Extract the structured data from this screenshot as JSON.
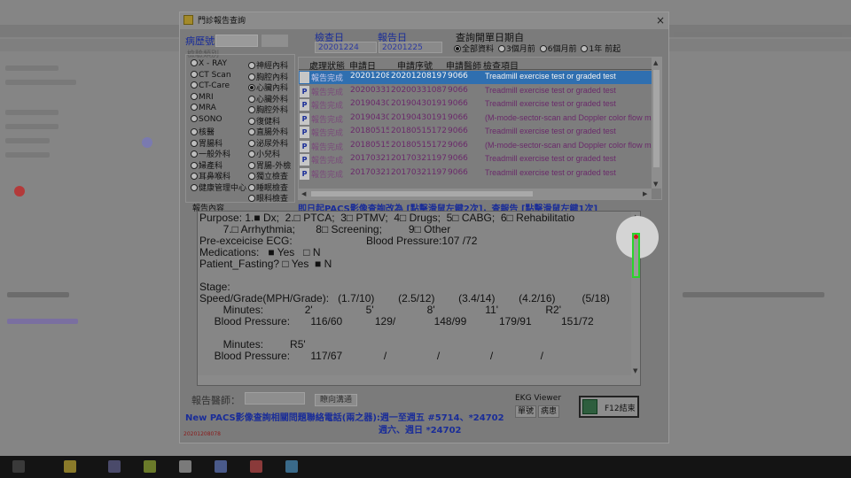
{
  "window": {
    "title": "門診報告查詢",
    "close": "×"
  },
  "top": {
    "chart_no_label": "病歷號",
    "exam_date_label": "檢查日",
    "exam_date": "20201224",
    "report_date_label": "報告日",
    "report_date": "20201225",
    "query_label": "查詢開單日期自",
    "ranges": [
      {
        "label": "全部資料",
        "selected": true
      },
      {
        "label": "3個月前",
        "selected": false
      },
      {
        "label": "6個月前",
        "selected": false
      },
      {
        "label": "1年 前起",
        "selected": false
      }
    ]
  },
  "category": {
    "legend": "檢驗類別",
    "left": [
      {
        "label": "X - RAY",
        "selected": false
      },
      {
        "label": "CT Scan",
        "selected": false
      },
      {
        "label": "CT-Care",
        "selected": false
      },
      {
        "label": "MRI",
        "selected": false
      },
      {
        "label": "MRA",
        "selected": false
      },
      {
        "label": "SONO",
        "selected": false
      },
      {
        "label": "核醫",
        "selected": false
      },
      {
        "label": "胃腸科",
        "selected": false
      },
      {
        "label": "一般外科",
        "selected": false
      },
      {
        "label": "婦產科",
        "selected": false
      },
      {
        "label": "耳鼻喉科",
        "selected": false
      },
      {
        "label": "健康管理中心",
        "selected": false
      }
    ],
    "right": [
      {
        "label": "神經內科",
        "selected": false
      },
      {
        "label": "胸腔內科",
        "selected": false
      },
      {
        "label": "心臟內科",
        "selected": true
      },
      {
        "label": "心臟外科",
        "selected": false
      },
      {
        "label": "胸腔外科",
        "selected": false
      },
      {
        "label": "復健科",
        "selected": false
      },
      {
        "label": "直腸外科",
        "selected": false
      },
      {
        "label": "泌尿外科",
        "selected": false
      },
      {
        "label": "小兒科",
        "selected": false
      },
      {
        "label": "胃腸-外檢",
        "selected": false
      },
      {
        "label": "獨立檢查",
        "selected": false
      },
      {
        "label": "睡眠檢查",
        "selected": false
      },
      {
        "label": "眼科檢查",
        "selected": false
      }
    ]
  },
  "table": {
    "headers": [
      "處理狀態",
      "申請日",
      "申請序號",
      "申請醫師",
      "檢查項目"
    ],
    "rows": [
      {
        "marker": "",
        "status": "報告完成",
        "date": "20201208",
        "serial": "202012081978",
        "doctor": "9066",
        "item": "Treadmill exercise test or graded test",
        "selected": true
      },
      {
        "marker": "P",
        "status": "報告完成",
        "date": "20200331",
        "serial": "202003310875",
        "doctor": "9066",
        "item": "Treadmill exercise test or graded test",
        "selected": false
      },
      {
        "marker": "P",
        "status": "報告完成",
        "date": "20190430",
        "serial": "201904301914",
        "doctor": "9066",
        "item": "Treadmill exercise test or graded test",
        "selected": false
      },
      {
        "marker": "P",
        "status": "報告完成",
        "date": "20190430",
        "serial": "201904301913",
        "doctor": "9066",
        "item": "(M-mode-sector-scan and Doppler color flow m",
        "selected": false
      },
      {
        "marker": "P",
        "status": "報告完成",
        "date": "20180515",
        "serial": "201805151725",
        "doctor": "9066",
        "item": "Treadmill exercise test or graded test",
        "selected": false
      },
      {
        "marker": "P",
        "status": "報告完成",
        "date": "20180515",
        "serial": "201805151724",
        "doctor": "9066",
        "item": "(M-mode-sector-scan and Doppler color flow m",
        "selected": false
      },
      {
        "marker": "P",
        "status": "報告完成",
        "date": "20170321",
        "serial": "201703211978",
        "doctor": "9066",
        "item": "Treadmill exercise test or graded test",
        "selected": false
      },
      {
        "marker": "P",
        "status": "報告完成",
        "date": "20170321",
        "serial": "201703211979",
        "doctor": "9066",
        "item": "Treadmill exercise test or graded test",
        "selected": false
      }
    ]
  },
  "notice": "即日起PACS影像查詢改為 [點擊滑鼠左鍵2次]，查報告 [點擊滑鼠左鍵1次]",
  "report": {
    "legend": "報告內容",
    "lines": [
      "Purpose: 1.■ Dx;  2.□ PTCA;  3□ PTMV;  4□ Drugs;  5□ CABG;  6□ Rehabilitatio",
      "        7.□ Arrhythmia;       8□ Screening;         9□ Other",
      "Pre-exceicise ECG:                         Blood Pressure:107 /72",
      "Medications:   ■ Yes   □ N",
      "Patient_Fasting? □ Yes  ■ N",
      "",
      "Stage:",
      "Speed/Grade(MPH/Grade):   (1.7/10)        (2.5/12)        (3.4/14)        (4.2/16)         (5/18)",
      "        Minutes:              2'                  5'                  8'                 11'                R2'",
      "     Blood Pressure:       116/60           129/             148/99           179/91          151/72",
      "",
      "        Minutes:         R5'",
      "     Blood Pressure:       117/67              /                 /                 /                /",
      "",
      ""
    ]
  },
  "footer": {
    "doctor_label": "報告醫師：",
    "ack_button": "瞭向溝通",
    "ekg_label": "EKG Viewer",
    "ekg_single": "單號",
    "ekg_patient": "病患",
    "f12_button": "F12結束",
    "contact_line1": "New PACS影像查詢相關問題聯絡電話(兩之器):週一至週五 #5714、*24702",
    "contact_line2": "週六、週日 *24702",
    "code": "20201208078"
  }
}
